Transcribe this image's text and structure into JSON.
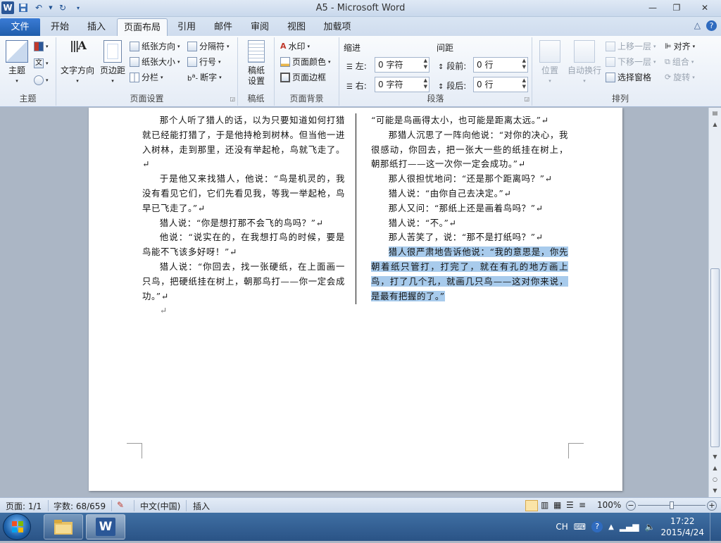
{
  "window": {
    "title": "A5 - Microsoft Word",
    "app_logo": "W",
    "controls": {
      "minimize": "—",
      "maximize": "❐",
      "close": "✕"
    }
  },
  "ribbon_tabs": [
    {
      "label": "文件",
      "active": false
    },
    {
      "label": "开始",
      "active": false
    },
    {
      "label": "插入",
      "active": false
    },
    {
      "label": "页面布局",
      "active": true
    },
    {
      "label": "引用",
      "active": false
    },
    {
      "label": "邮件",
      "active": false
    },
    {
      "label": "审阅",
      "active": false
    },
    {
      "label": "视图",
      "active": false
    },
    {
      "label": "加载项",
      "active": false
    }
  ],
  "ribbon": {
    "theme_group": {
      "label": "主题",
      "themes_button": "主题"
    },
    "page_setup_group": {
      "label": "页面设置",
      "text_direction": "文字方向",
      "margins": "页边距",
      "orientation": "纸张方向",
      "size": "纸张大小",
      "columns": "分栏",
      "breaks": "分隔符",
      "line_numbers": "行号",
      "hyphenation": "断字"
    },
    "paper_group": {
      "label": "稿纸",
      "button": "稿纸\n设置"
    },
    "page_background_group": {
      "label": "页面背景",
      "watermark": "水印",
      "page_color": "页面颜色",
      "page_borders": "页面边框"
    },
    "paragraph_group": {
      "label": "段落",
      "indent_header": "缩进",
      "spacing_header": "间距",
      "left_label": "左:",
      "left_value": "0 字符",
      "right_label": "右:",
      "right_value": "0 字符",
      "before_label": "段前:",
      "before_value": "0 行",
      "after_label": "段后:",
      "after_value": "0 行"
    },
    "arrange_group": {
      "label": "排列",
      "position": "位置",
      "wrap_text": "自动换行",
      "bring_forward": "上移一层",
      "send_backward": "下移一层",
      "selection_pane": "选择窗格",
      "align": "对齐",
      "group": "组合",
      "rotate": "旋转"
    }
  },
  "document": {
    "left_column": [
      "那个人听了猎人的话，以为只要知道如何打猎就已经能打猎了，于是他持枪到树林。但当他一进入树林，走到那里，还没有举起枪，鸟就飞走了。↵",
      "于是他又来找猎人，他说：“鸟是机灵的，我没有看见它们，它们先看见我，等我一举起枪，鸟早已飞走了。”↵",
      "猎人说：“你是想打那不会飞的鸟吗？”↵",
      "他说：“说实在的，在我想打鸟的时候，要是鸟能不飞该多好呀！”↵",
      "猎人说：“你回去，找一张硬纸，在上面画一只鸟，把硬纸挂在树上，朝那鸟打——你一定会成功。”↵",
      "↵"
    ],
    "right_column": [
      "“可能是鸟画得太小，也可能是距离太远。”↵",
      "那猎人沉思了一阵向他说：“对你的决心，我很感动，你回去，把一张大一些的纸挂在树上，朝那纸打——这一次你一定会成功。”↵",
      "那人很担忧地问：“还是那个距离吗？”↵",
      "猎人说：“由你自己去决定。”↵",
      "那人又问：“那纸上还是画着鸟吗？”↵",
      "猎人说：“不。”↵",
      "那人苦笑了，说：“那不是打纸吗？”↵"
    ],
    "selected_paragraph": "猎人很严肃地告诉他说：“我的意思是，你先朝着纸只管打，打完了，就在有孔的地方画上鸟，打了几个孔，就画几只鸟——这对你来说，是最有把握的了。”"
  },
  "statusbar": {
    "page": "页面: 1/1",
    "word_count": "字数: 68/659",
    "language": "中文(中国)",
    "mode": "插入",
    "zoom": "100%",
    "zoom_level_percent": 100,
    "zoom_minus": "−",
    "zoom_plus": "+"
  },
  "taskbar": {
    "ime": "CH",
    "time": "17:22",
    "date": "2015/4/24"
  },
  "colors": {
    "file_tab": "#2a66b8",
    "selection": "#a8cbec",
    "taskbar": "#2f5b92"
  }
}
